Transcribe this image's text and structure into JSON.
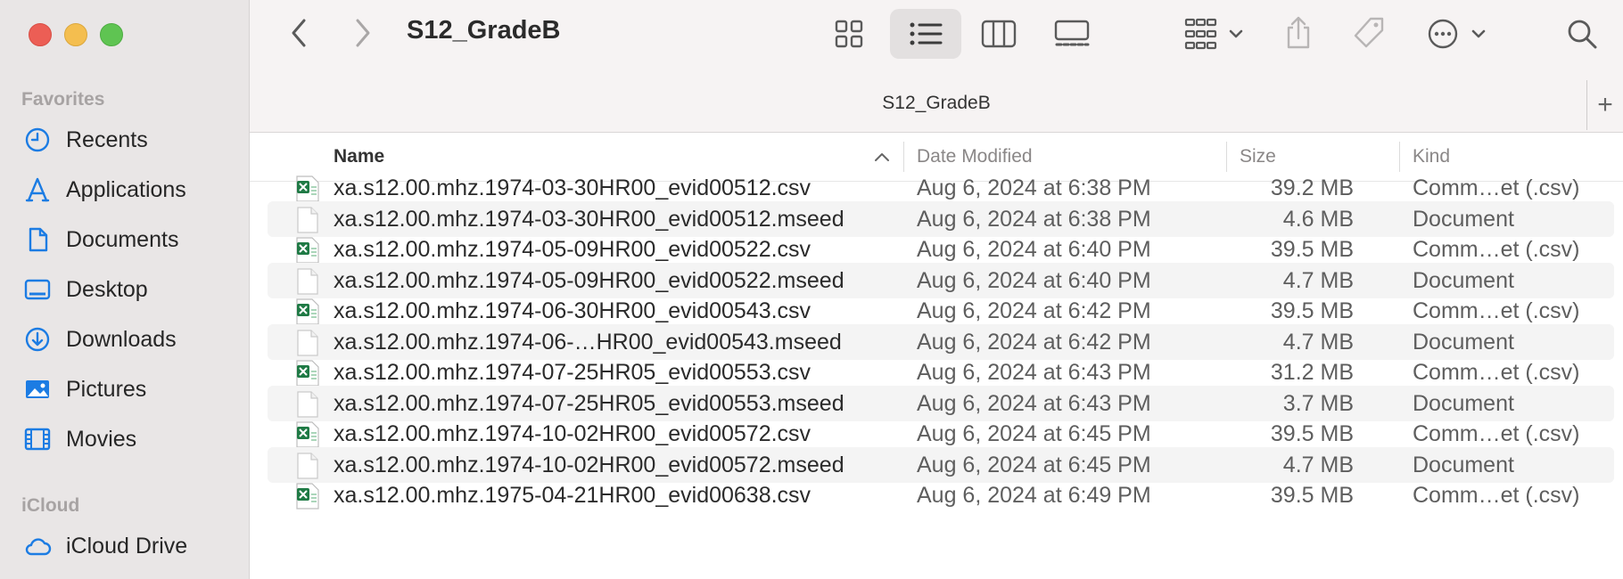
{
  "window": {
    "title": "S12_GradeB",
    "path_title": "S12_GradeB"
  },
  "colors": {
    "sidebar_bg": "#e9e6e6",
    "accent": "#1c7ce3",
    "toolbar_bg": "#f6f3f3",
    "row_alt": "#f4f4f4"
  },
  "sidebar": {
    "favorites_heading": "Favorites",
    "favorites": [
      {
        "label": "Recents",
        "icon": "clock-icon"
      },
      {
        "label": "Applications",
        "icon": "applications-icon"
      },
      {
        "label": "Documents",
        "icon": "document-icon"
      },
      {
        "label": "Desktop",
        "icon": "desktop-icon"
      },
      {
        "label": "Downloads",
        "icon": "download-icon"
      },
      {
        "label": "Pictures",
        "icon": "photo-icon"
      },
      {
        "label": "Movies",
        "icon": "film-icon"
      }
    ],
    "icloud_heading": "iCloud",
    "icloud": [
      {
        "label": "iCloud Drive",
        "icon": "cloud-icon"
      }
    ]
  },
  "toolbar": {
    "add_tab_label": "+",
    "icons": [
      "back-icon",
      "forward-icon",
      "icon-view-icon",
      "list-view-icon",
      "column-view-icon",
      "gallery-view-icon",
      "group-icon",
      "share-icon",
      "tag-icon",
      "more-icon",
      "search-icon"
    ]
  },
  "columns": {
    "name": "Name",
    "date": "Date Modified",
    "size": "Size",
    "kind": "Kind"
  },
  "files": [
    {
      "name": "xa.s12.00.mhz.1974-03-30HR00_evid00512.csv",
      "date": "Aug 6, 2024 at 6:38 PM",
      "size": "39.2 MB",
      "kind": "Comm…et (.csv)",
      "type": "csv"
    },
    {
      "name": "xa.s12.00.mhz.1974-03-30HR00_evid00512.mseed",
      "date": "Aug 6, 2024 at 6:38 PM",
      "size": "4.6 MB",
      "kind": "Document",
      "type": "doc"
    },
    {
      "name": "xa.s12.00.mhz.1974-05-09HR00_evid00522.csv",
      "date": "Aug 6, 2024 at 6:40 PM",
      "size": "39.5 MB",
      "kind": "Comm…et (.csv)",
      "type": "csv"
    },
    {
      "name": "xa.s12.00.mhz.1974-05-09HR00_evid00522.mseed",
      "date": "Aug 6, 2024 at 6:40 PM",
      "size": "4.7 MB",
      "kind": "Document",
      "type": "doc"
    },
    {
      "name": "xa.s12.00.mhz.1974-06-30HR00_evid00543.csv",
      "date": "Aug 6, 2024 at 6:42 PM",
      "size": "39.5 MB",
      "kind": "Comm…et (.csv)",
      "type": "csv"
    },
    {
      "name": "xa.s12.00.mhz.1974-06-…HR00_evid00543.mseed",
      "date": "Aug 6, 2024 at 6:42 PM",
      "size": "4.7 MB",
      "kind": "Document",
      "type": "doc"
    },
    {
      "name": "xa.s12.00.mhz.1974-07-25HR05_evid00553.csv",
      "date": "Aug 6, 2024 at 6:43 PM",
      "size": "31.2 MB",
      "kind": "Comm…et (.csv)",
      "type": "csv"
    },
    {
      "name": "xa.s12.00.mhz.1974-07-25HR05_evid00553.mseed",
      "date": "Aug 6, 2024 at 6:43 PM",
      "size": "3.7 MB",
      "kind": "Document",
      "type": "doc"
    },
    {
      "name": "xa.s12.00.mhz.1974-10-02HR00_evid00572.csv",
      "date": "Aug 6, 2024 at 6:45 PM",
      "size": "39.5 MB",
      "kind": "Comm…et (.csv)",
      "type": "csv"
    },
    {
      "name": "xa.s12.00.mhz.1974-10-02HR00_evid00572.mseed",
      "date": "Aug 6, 2024 at 6:45 PM",
      "size": "4.7 MB",
      "kind": "Document",
      "type": "doc"
    },
    {
      "name": "xa.s12.00.mhz.1975-04-21HR00_evid00638.csv",
      "date": "Aug 6, 2024 at 6:49 PM",
      "size": "39.5 MB",
      "kind": "Comm…et (.csv)",
      "type": "csv"
    }
  ]
}
